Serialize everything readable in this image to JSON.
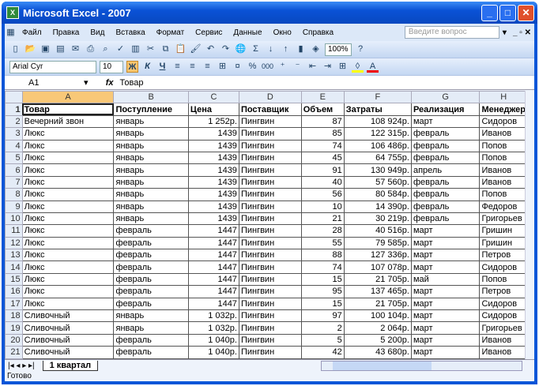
{
  "window": {
    "title": "Microsoft Excel - 2007"
  },
  "menu": [
    "Файл",
    "Правка",
    "Вид",
    "Вставка",
    "Формат",
    "Сервис",
    "Данные",
    "Окно",
    "Справка"
  ],
  "help_placeholder": "Введите вопрос",
  "toolbar": {
    "zoom": "100%",
    "font": "Arial Cyr",
    "size": "10",
    "bold": "Ж",
    "italic": "К",
    "underline": "Ч",
    "percent": "%",
    "thousands": "000"
  },
  "formula": {
    "cell": "A1",
    "fx": "fx",
    "value": "Товар"
  },
  "columns": [
    "A",
    "B",
    "C",
    "D",
    "E",
    "F",
    "G",
    "H"
  ],
  "rows": [
    [
      "Товар",
      "Поступление",
      "Цена",
      "Поставщик",
      "Объем",
      "Затраты",
      "Реализация",
      "Менеджер"
    ],
    [
      "Вечерний звон",
      "январь",
      "1 252р.",
      "Пингвин",
      "87",
      "108 924р.",
      "март",
      "Сидоров"
    ],
    [
      "Люкс",
      "январь",
      "1439",
      "Пингвин",
      "85",
      "122 315р.",
      "февраль",
      "Иванов"
    ],
    [
      "Люкс",
      "январь",
      "1439",
      "Пингвин",
      "74",
      "106 486р.",
      "февраль",
      "Попов"
    ],
    [
      "Люкс",
      "январь",
      "1439",
      "Пингвин",
      "45",
      "64 755р.",
      "февраль",
      "Попов"
    ],
    [
      "Люкс",
      "январь",
      "1439",
      "Пингвин",
      "91",
      "130 949р.",
      "апрель",
      "Иванов"
    ],
    [
      "Люкс",
      "январь",
      "1439",
      "Пингвин",
      "40",
      "57 560р.",
      "февраль",
      "Иванов"
    ],
    [
      "Люкс",
      "январь",
      "1439",
      "Пингвин",
      "56",
      "80 584р.",
      "февраль",
      "Попов"
    ],
    [
      "Люкс",
      "январь",
      "1439",
      "Пингвин",
      "10",
      "14 390р.",
      "февраль",
      "Федоров"
    ],
    [
      "Люкс",
      "январь",
      "1439",
      "Пингвин",
      "21",
      "30 219р.",
      "февраль",
      "Григорьев"
    ],
    [
      "Люкс",
      "февраль",
      "1447",
      "Пингвин",
      "28",
      "40 516р.",
      "март",
      "Гришин"
    ],
    [
      "Люкс",
      "февраль",
      "1447",
      "Пингвин",
      "55",
      "79 585р.",
      "март",
      "Гришин"
    ],
    [
      "Люкс",
      "февраль",
      "1447",
      "Пингвин",
      "88",
      "127 336р.",
      "март",
      "Петров"
    ],
    [
      "Люкс",
      "февраль",
      "1447",
      "Пингвин",
      "74",
      "107 078р.",
      "март",
      "Сидоров"
    ],
    [
      "Люкс",
      "февраль",
      "1447",
      "Пингвин",
      "15",
      "21 705р.",
      "май",
      "Попов"
    ],
    [
      "Люкс",
      "февраль",
      "1447",
      "Пингвин",
      "95",
      "137 465р.",
      "март",
      "Петров"
    ],
    [
      "Люкс",
      "февраль",
      "1447",
      "Пингвин",
      "15",
      "21 705р.",
      "март",
      "Сидоров"
    ],
    [
      "Сливочный",
      "январь",
      "1 032р.",
      "Пингвин",
      "97",
      "100 104р.",
      "март",
      "Сидоров"
    ],
    [
      "Сливочный",
      "январь",
      "1 032р.",
      "Пингвин",
      "2",
      "2 064р.",
      "март",
      "Григорьев"
    ],
    [
      "Сливочный",
      "февраль",
      "1 040р.",
      "Пингвин",
      "5",
      "5 200р.",
      "март",
      "Иванов"
    ],
    [
      "Сливочный",
      "февраль",
      "1 040р.",
      "Пингвин",
      "42",
      "43 680р.",
      "март",
      "Иванов"
    ]
  ],
  "sheet_tab": "1 квартал",
  "status": "Готово"
}
